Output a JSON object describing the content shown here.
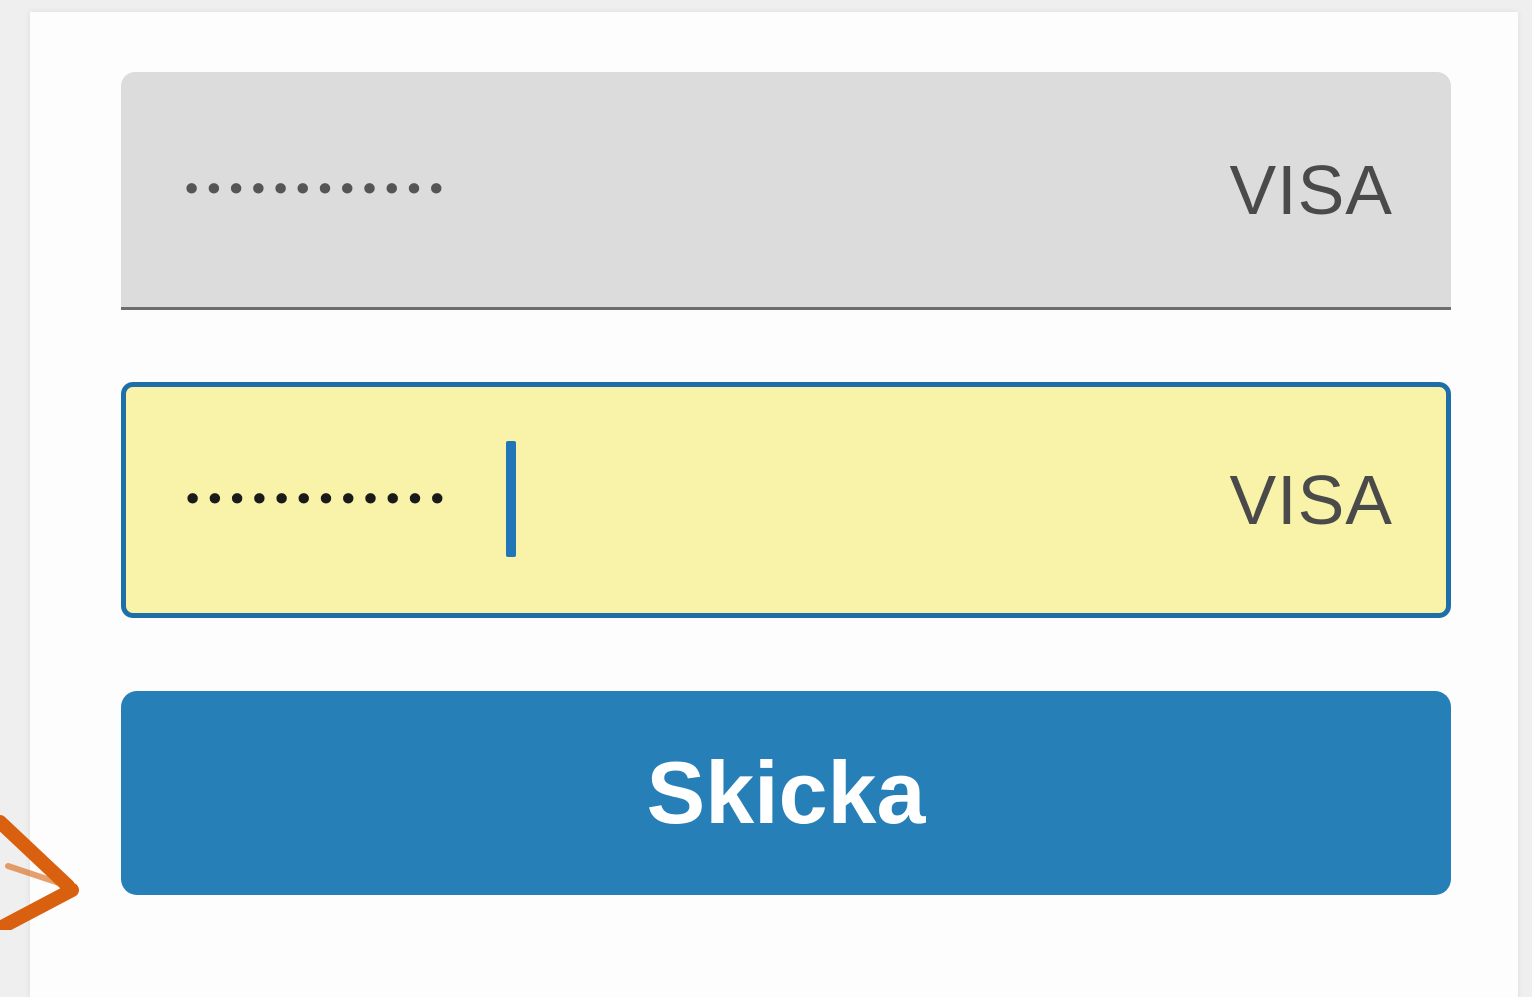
{
  "form": {
    "card_number_masked": "••••••••••••",
    "card_number_brand": "VISA",
    "confirm_number_masked": "••••••••••••",
    "confirm_number_brand": "VISA",
    "submit_label": "Skicka"
  },
  "colors": {
    "focused_field_bg": "#f8f3a8",
    "focus_border": "#1e6fa8",
    "button_bg": "#2680b7",
    "arrow": "#d9600e"
  },
  "icons": {
    "arrow": "arrow-right-icon"
  }
}
